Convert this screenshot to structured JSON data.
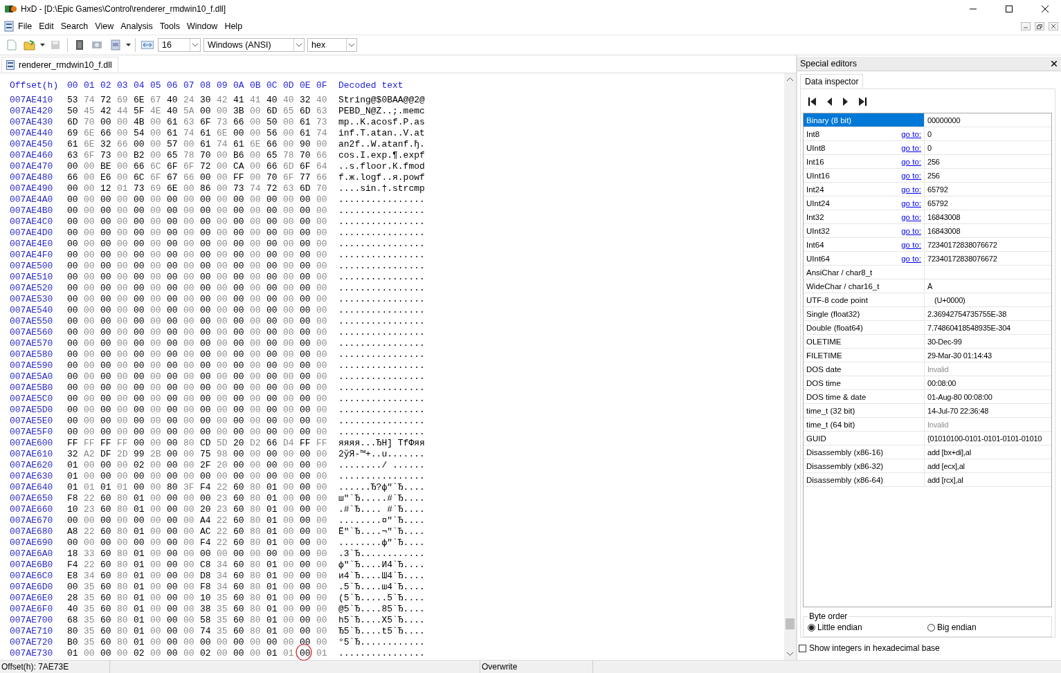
{
  "window": {
    "title": "HxD - [D:\\Epic Games\\Control\\renderer_rmdwin10_f.dll]"
  },
  "menu": [
    "File",
    "Edit",
    "Search",
    "View",
    "Analysis",
    "Tools",
    "Window",
    "Help"
  ],
  "toolbar": {
    "bytes_per_row": "16",
    "charset": "Windows (ANSI)",
    "offset_base": "hex"
  },
  "document_tab": {
    "label": "renderer_rmdwin10_f.dll",
    "selected": true
  },
  "hex_view": {
    "offset_header": "Offset(h)",
    "byte_headers": [
      "00",
      "01",
      "02",
      "03",
      "04",
      "05",
      "06",
      "07",
      "08",
      "09",
      "0A",
      "0B",
      "0C",
      "0D",
      "0E",
      "0F"
    ],
    "text_header": "Decoded text",
    "rows": [
      {
        "offset": "007AE410",
        "bytes": "53 74 72 69 6E 67 40 24 30 42 41 41 40 40 32 40",
        "text": "String@$0BAA@@2@"
      },
      {
        "offset": "007AE420",
        "bytes": "50 45 42 44 5F 4E 40 5A 00 00 3B 00 6D 65 6D 63",
        "text": "PEBD_N@Z..;.memc"
      },
      {
        "offset": "007AE430",
        "bytes": "6D 70 00 00 4B 00 61 63 6F 73 66 00 50 00 61 73",
        "text": "mp..K.acosf.P.as"
      },
      {
        "offset": "007AE440",
        "bytes": "69 6E 66 00 54 00 61 74 61 6E 00 00 56 00 61 74",
        "text": "inf.T.atan..V.at"
      },
      {
        "offset": "007AE450",
        "bytes": "61 6E 32 66 00 00 57 00 61 74 61 6E 66 00 90 00",
        "text": "an2f..W.atanf.ђ."
      },
      {
        "offset": "007AE460",
        "bytes": "63 6F 73 00 B2 00 65 78 70 00 B6 00 65 78 70 66",
        "text": "cos.I.exp.¶.expf"
      },
      {
        "offset": "007AE470",
        "bytes": "00 00 BE 00 66 6C 6F 6F 72 00 CA 00 66 6D 6F 64",
        "text": "..s.floor.К.fmod"
      },
      {
        "offset": "007AE480",
        "bytes": "66 00 E6 00 6C 6F 67 66 00 00 FF 00 70 6F 77 66",
        "text": "f.ж.logf..я.powf"
      },
      {
        "offset": "007AE490",
        "bytes": "00 00 12 01 73 69 6E 00 86 00 73 74 72 63 6D 70",
        "text": "....sin.†.strcmp"
      },
      {
        "offset": "007AE4A0",
        "bytes": "00 00 00 00 00 00 00 00 00 00 00 00 00 00 00 00",
        "text": "................"
      },
      {
        "offset": "007AE4B0",
        "bytes": "00 00 00 00 00 00 00 00 00 00 00 00 00 00 00 00",
        "text": "................"
      },
      {
        "offset": "007AE4C0",
        "bytes": "00 00 00 00 00 00 00 00 00 00 00 00 00 00 00 00",
        "text": "................"
      },
      {
        "offset": "007AE4D0",
        "bytes": "00 00 00 00 00 00 00 00 00 00 00 00 00 00 00 00",
        "text": "................"
      },
      {
        "offset": "007AE4E0",
        "bytes": "00 00 00 00 00 00 00 00 00 00 00 00 00 00 00 00",
        "text": "................"
      },
      {
        "offset": "007AE4F0",
        "bytes": "00 00 00 00 00 00 00 00 00 00 00 00 00 00 00 00",
        "text": "................"
      },
      {
        "offset": "007AE500",
        "bytes": "00 00 00 00 00 00 00 00 00 00 00 00 00 00 00 00",
        "text": "................"
      },
      {
        "offset": "007AE510",
        "bytes": "00 00 00 00 00 00 00 00 00 00 00 00 00 00 00 00",
        "text": "................"
      },
      {
        "offset": "007AE520",
        "bytes": "00 00 00 00 00 00 00 00 00 00 00 00 00 00 00 00",
        "text": "................"
      },
      {
        "offset": "007AE530",
        "bytes": "00 00 00 00 00 00 00 00 00 00 00 00 00 00 00 00",
        "text": "................"
      },
      {
        "offset": "007AE540",
        "bytes": "00 00 00 00 00 00 00 00 00 00 00 00 00 00 00 00",
        "text": "................"
      },
      {
        "offset": "007AE550",
        "bytes": "00 00 00 00 00 00 00 00 00 00 00 00 00 00 00 00",
        "text": "................"
      },
      {
        "offset": "007AE560",
        "bytes": "00 00 00 00 00 00 00 00 00 00 00 00 00 00 00 00",
        "text": "................"
      },
      {
        "offset": "007AE570",
        "bytes": "00 00 00 00 00 00 00 00 00 00 00 00 00 00 00 00",
        "text": "................"
      },
      {
        "offset": "007AE580",
        "bytes": "00 00 00 00 00 00 00 00 00 00 00 00 00 00 00 00",
        "text": "................"
      },
      {
        "offset": "007AE590",
        "bytes": "00 00 00 00 00 00 00 00 00 00 00 00 00 00 00 00",
        "text": "................"
      },
      {
        "offset": "007AE5A0",
        "bytes": "00 00 00 00 00 00 00 00 00 00 00 00 00 00 00 00",
        "text": "................"
      },
      {
        "offset": "007AE5B0",
        "bytes": "00 00 00 00 00 00 00 00 00 00 00 00 00 00 00 00",
        "text": "................"
      },
      {
        "offset": "007AE5C0",
        "bytes": "00 00 00 00 00 00 00 00 00 00 00 00 00 00 00 00",
        "text": "................"
      },
      {
        "offset": "007AE5D0",
        "bytes": "00 00 00 00 00 00 00 00 00 00 00 00 00 00 00 00",
        "text": "................"
      },
      {
        "offset": "007AE5E0",
        "bytes": "00 00 00 00 00 00 00 00 00 00 00 00 00 00 00 00",
        "text": "................"
      },
      {
        "offset": "007AE5F0",
        "bytes": "00 00 00 00 00 00 00 00 00 00 00 00 00 00 00 00",
        "text": "................"
      },
      {
        "offset": "007AE600",
        "bytes": "FF FF FF FF 00 00 00 80 CD 5D 20 D2 66 D4 FF FF",
        "text": "яяяя...ЂН] ТfФяя"
      },
      {
        "offset": "007AE610",
        "bytes": "32 A2 DF 2D 99 2B 00 00 75 98 00 00 00 00 00 00",
        "text": "2ўЯ-™+..u......."
      },
      {
        "offset": "007AE620",
        "bytes": "01 00 00 00 02 00 00 00 2F 20 00 00 00 00 00 00",
        "text": "......../ ......"
      },
      {
        "offset": "007AE630",
        "bytes": "01 00 00 00 00 00 00 00 00 00 00 00 00 00 00 00",
        "text": "................"
      },
      {
        "offset": "007AE640",
        "bytes": "01 01 01 01 00 00 80 3F F4 22 60 80 01 00 00 00",
        "text": "......Ђ?ф\"`Ђ...."
      },
      {
        "offset": "007AE650",
        "bytes": "F8 22 60 80 01 00 00 00 00 23 60 80 01 00 00 00",
        "text": "ш\"`Ђ.....#`Ђ...."
      },
      {
        "offset": "007AE660",
        "bytes": "10 23 60 80 01 00 00 00 20 23 60 80 01 00 00 00",
        "text": ".#`Ђ.... #`Ђ...."
      },
      {
        "offset": "007AE670",
        "bytes": "00 00 00 00 00 00 00 00 A4 22 60 80 01 00 00 00",
        "text": "........¤\"`Ђ...."
      },
      {
        "offset": "007AE680",
        "bytes": "A8 22 60 80 01 00 00 00 AC 22 60 80 01 00 00 00",
        "text": "Ё\"`Ђ....¬\"`Ђ...."
      },
      {
        "offset": "007AE690",
        "bytes": "00 00 00 00 00 00 00 00 F4 22 60 80 01 00 00 00",
        "text": "........ф\"`Ђ...."
      },
      {
        "offset": "007AE6A0",
        "bytes": "18 33 60 80 01 00 00 00 00 00 00 00 00 00 00 00",
        "text": ".3`Ђ............"
      },
      {
        "offset": "007AE6B0",
        "bytes": "F4 22 60 80 01 00 00 00 C8 34 60 80 01 00 00 00",
        "text": "ф\"`Ђ....И4`Ђ...."
      },
      {
        "offset": "007AE6C0",
        "bytes": "E8 34 60 80 01 00 00 00 D8 34 60 80 01 00 00 00",
        "text": "и4`Ђ....Ш4`Ђ...."
      },
      {
        "offset": "007AE6D0",
        "bytes": "00 35 60 80 01 00 00 00 F8 34 60 80 01 00 00 00",
        "text": ".5`Ђ....ш4`Ђ...."
      },
      {
        "offset": "007AE6E0",
        "bytes": "28 35 60 80 01 00 00 00 10 35 60 80 01 00 00 00",
        "text": "(5`Ђ.....5`Ђ...."
      },
      {
        "offset": "007AE6F0",
        "bytes": "40 35 60 80 01 00 00 00 38 35 60 80 01 00 00 00",
        "text": "@5`Ђ....85`Ђ...."
      },
      {
        "offset": "007AE700",
        "bytes": "68 35 60 80 01 00 00 00 58 35 60 80 01 00 00 00",
        "text": "h5`Ђ....X5`Ђ...."
      },
      {
        "offset": "007AE710",
        "bytes": "80 35 60 80 01 00 00 00 74 35 60 80 01 00 00 00",
        "text": "Ђ5`Ђ....t5`Ђ...."
      },
      {
        "offset": "007AE720",
        "bytes": "B0 35 60 80 01 00 00 00 00 00 00 00 00 00 00 00",
        "text": "°5`Ђ............"
      },
      {
        "offset": "007AE730",
        "bytes": "01 00 00 00 02 00 00 00 02 00 00 00 01 01 00 01",
        "text": "................"
      }
    ]
  },
  "special_editors": {
    "title": "Special editors",
    "tab": {
      "label": "Data inspector",
      "selected": true
    },
    "fields": [
      {
        "label": "Binary (8 bit)",
        "goto": false,
        "value": "00000000",
        "selected": true,
        "invalid": false
      },
      {
        "label": "Int8",
        "goto": true,
        "link": "go to:",
        "value": "0",
        "selected": false,
        "invalid": false
      },
      {
        "label": "UInt8",
        "goto": true,
        "link": "go to:",
        "value": "0",
        "selected": false,
        "invalid": false
      },
      {
        "label": "Int16",
        "goto": true,
        "link": "go to:",
        "value": "256",
        "selected": false,
        "invalid": false
      },
      {
        "label": "UInt16",
        "goto": true,
        "link": "go to:",
        "value": "256",
        "selected": false,
        "invalid": false
      },
      {
        "label": "Int24",
        "goto": true,
        "link": "go to:",
        "value": "65792",
        "selected": false,
        "invalid": false
      },
      {
        "label": "UInt24",
        "goto": true,
        "link": "go to:",
        "value": "65792",
        "selected": false,
        "invalid": false
      },
      {
        "label": "Int32",
        "goto": true,
        "link": "go to:",
        "value": "16843008",
        "selected": false,
        "invalid": false
      },
      {
        "label": "UInt32",
        "goto": true,
        "link": "go to:",
        "value": "16843008",
        "selected": false,
        "invalid": false
      },
      {
        "label": "Int64",
        "goto": true,
        "link": "go to:",
        "value": "72340172838076672",
        "selected": false,
        "invalid": false
      },
      {
        "label": "UInt64",
        "goto": true,
        "link": "go to:",
        "value": "72340172838076672",
        "selected": false,
        "invalid": false
      },
      {
        "label": "AnsiChar / char8_t",
        "goto": false,
        "selected": false
      },
      {
        "label": "WideChar / char16_t",
        "goto": false,
        "value": "Ā",
        "selected": false,
        "invalid": false
      },
      {
        "label": "UTF-8 code point",
        "goto": false,
        "value": "(U+0000)",
        "selected": false,
        "invalid": false
      },
      {
        "label": "Single (float32)",
        "goto": false,
        "value": "2.36942754735755E-38",
        "selected": false,
        "invalid": false
      },
      {
        "label": "Double (float64)",
        "goto": false,
        "value": "7.74860418548935E-304",
        "selected": false,
        "invalid": false
      },
      {
        "label": "OLETIME",
        "goto": false,
        "value": "30-Dec-99",
        "selected": false,
        "invalid": false
      },
      {
        "label": "FILETIME",
        "goto": false,
        "value": "29-Mar-30 01:14:43",
        "selected": false,
        "invalid": false
      },
      {
        "label": "DOS date",
        "goto": false,
        "value": "Invalid",
        "selected": false,
        "invalid": true
      },
      {
        "label": "DOS time",
        "goto": false,
        "value": "00:08:00",
        "selected": false,
        "invalid": false
      },
      {
        "label": "DOS time & date",
        "goto": false,
        "value": "01-Aug-80 00:08:00",
        "selected": false,
        "invalid": false
      },
      {
        "label": "time_t (32 bit)",
        "goto": false,
        "value": "14-Jul-70 22:36:48",
        "selected": false,
        "invalid": false
      },
      {
        "label": "time_t (64 bit)",
        "goto": false,
        "value": "Invalid",
        "selected": false,
        "invalid": true
      },
      {
        "label": "GUID",
        "goto": false,
        "value": "{01010100-0101-0101-0101-01010",
        "selected": false,
        "invalid": false
      },
      {
        "label": "Disassembly (x86-16)",
        "goto": false,
        "value": "add [bx+di],al",
        "selected": false,
        "invalid": false
      },
      {
        "label": "Disassembly (x86-32)",
        "goto": false,
        "value": "add [ecx],al",
        "selected": false,
        "invalid": false
      },
      {
        "label": "Disassembly (x86-64)",
        "goto": false,
        "value": "add [rcx],al",
        "selected": false,
        "invalid": false
      }
    ],
    "byte_order": {
      "title": "Byte order",
      "options": [
        {
          "label": "Little endian",
          "selected": true
        },
        {
          "label": "Big endian",
          "selected": false
        }
      ]
    },
    "hex_integers": {
      "label": "Show integers in hexadecimal base",
      "checked": false
    }
  },
  "status_bar": {
    "offset": "Offset(h): 7AE73E",
    "mode": "Overwrite"
  }
}
